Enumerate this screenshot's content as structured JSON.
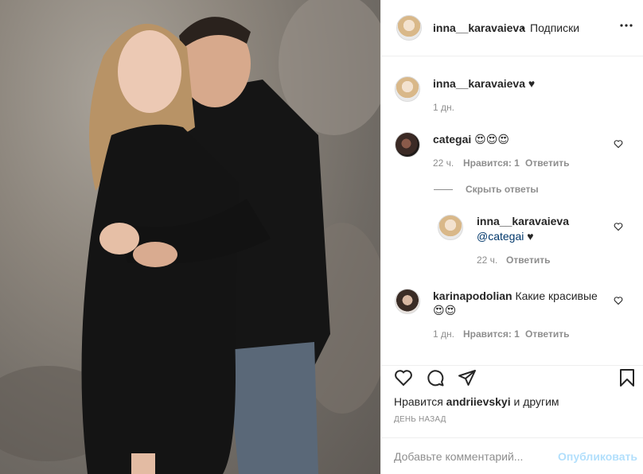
{
  "header": {
    "username": "inna__karavaieva",
    "dot": "•",
    "follow_label": "Подписки",
    "more_icon": "more-dots-icon"
  },
  "caption": {
    "username": "inna__karavaieva",
    "text": "♥",
    "time": "1 дн."
  },
  "comments": [
    {
      "username": "categai",
      "text": "😍😍😍",
      "time": "22 ч.",
      "likes": "Нравится: 1",
      "reply_label": "Ответить"
    },
    {
      "username": "karinapodolian",
      "text": "Какие красивые",
      "text2": "😍😍",
      "time": "1 дн.",
      "likes": "Нравится: 1",
      "reply_label": "Ответить"
    }
  ],
  "hide_replies_label": "Скрыть ответы",
  "reply": {
    "username": "inna__karavaieva",
    "mention": "@categai",
    "text": "♥",
    "time": "22 ч.",
    "reply_label": "Ответить"
  },
  "likes_line": {
    "prefix": "Нравится",
    "user": "andriievskyi",
    "suffix": "и другим"
  },
  "date_label": "ДЕНЬ НАЗАД",
  "add_comment": {
    "placeholder": "Добавьте комментарий...",
    "publish_label": "Опубликовать"
  },
  "icons": {
    "like": "heart-icon",
    "comment": "comment-icon",
    "share": "share-icon",
    "save": "bookmark-icon"
  }
}
